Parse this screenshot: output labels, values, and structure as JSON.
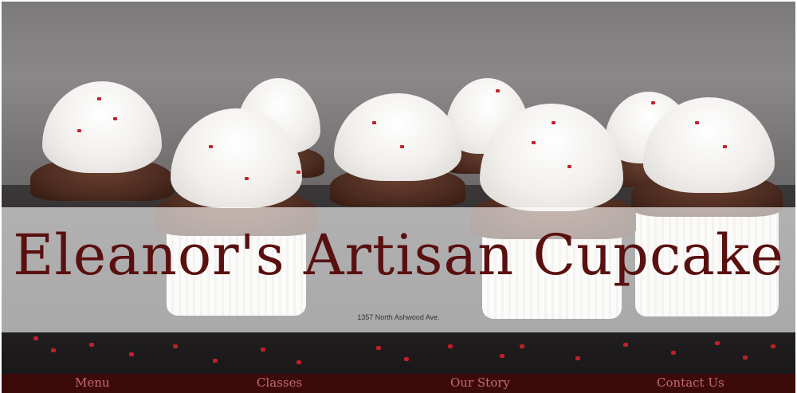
{
  "site": {
    "title": "Eleanor's Artisan Cupcake",
    "address": "1357 North Ashwood Ave."
  },
  "hero": {
    "image": "cupcakes-photo"
  },
  "nav": {
    "items": [
      {
        "label": "Menu"
      },
      {
        "label": "Classes"
      },
      {
        "label": "Our Story"
      },
      {
        "label": "Contact Us"
      }
    ]
  },
  "colors": {
    "brand": "#5a1010",
    "nav_bg": "#3d0a0a",
    "nav_text": "#c56a6a"
  }
}
